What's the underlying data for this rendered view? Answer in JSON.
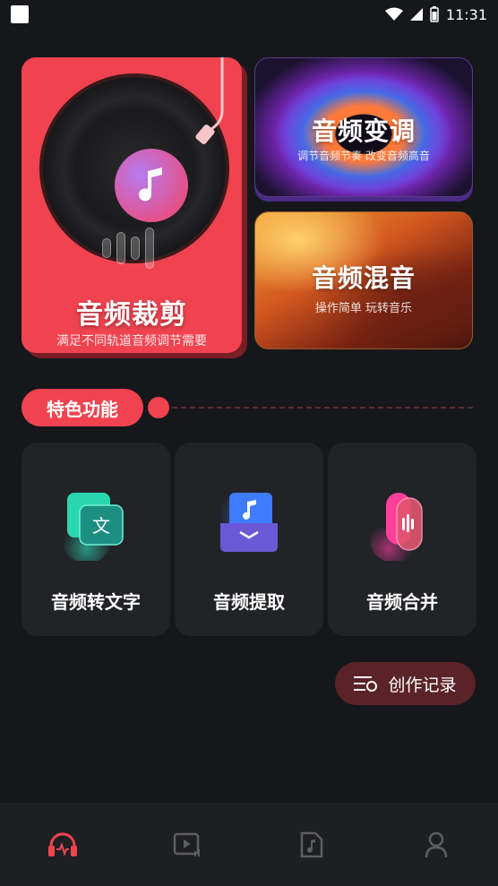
{
  "status_bar": {
    "time": "11:31"
  },
  "cards": {
    "cut": {
      "title": "音频裁剪",
      "subtitle": "满足不同轨道音频调节需要"
    },
    "pitch": {
      "title": "音频变调",
      "subtitle": "调节音频节奏 改变音频高音"
    },
    "mix": {
      "title": "音频混音",
      "subtitle": "操作简单 玩转音乐"
    }
  },
  "section": {
    "title": "特色功能"
  },
  "tiles": [
    {
      "label": "音频转文字",
      "icon": "text-convert-icon"
    },
    {
      "label": "音频提取",
      "icon": "extract-icon"
    },
    {
      "label": "音频合并",
      "icon": "merge-icon"
    }
  ],
  "history_button": {
    "label": "创作记录",
    "icon": "list-icon"
  },
  "bottom_nav": [
    {
      "icon": "headphones-icon",
      "active": true
    },
    {
      "icon": "video-icon",
      "active": false
    },
    {
      "icon": "music-file-icon",
      "active": false
    },
    {
      "icon": "user-icon",
      "active": false
    }
  ],
  "colors": {
    "accent": "#f0434f",
    "background": "#16171b",
    "tile": "#222327"
  }
}
